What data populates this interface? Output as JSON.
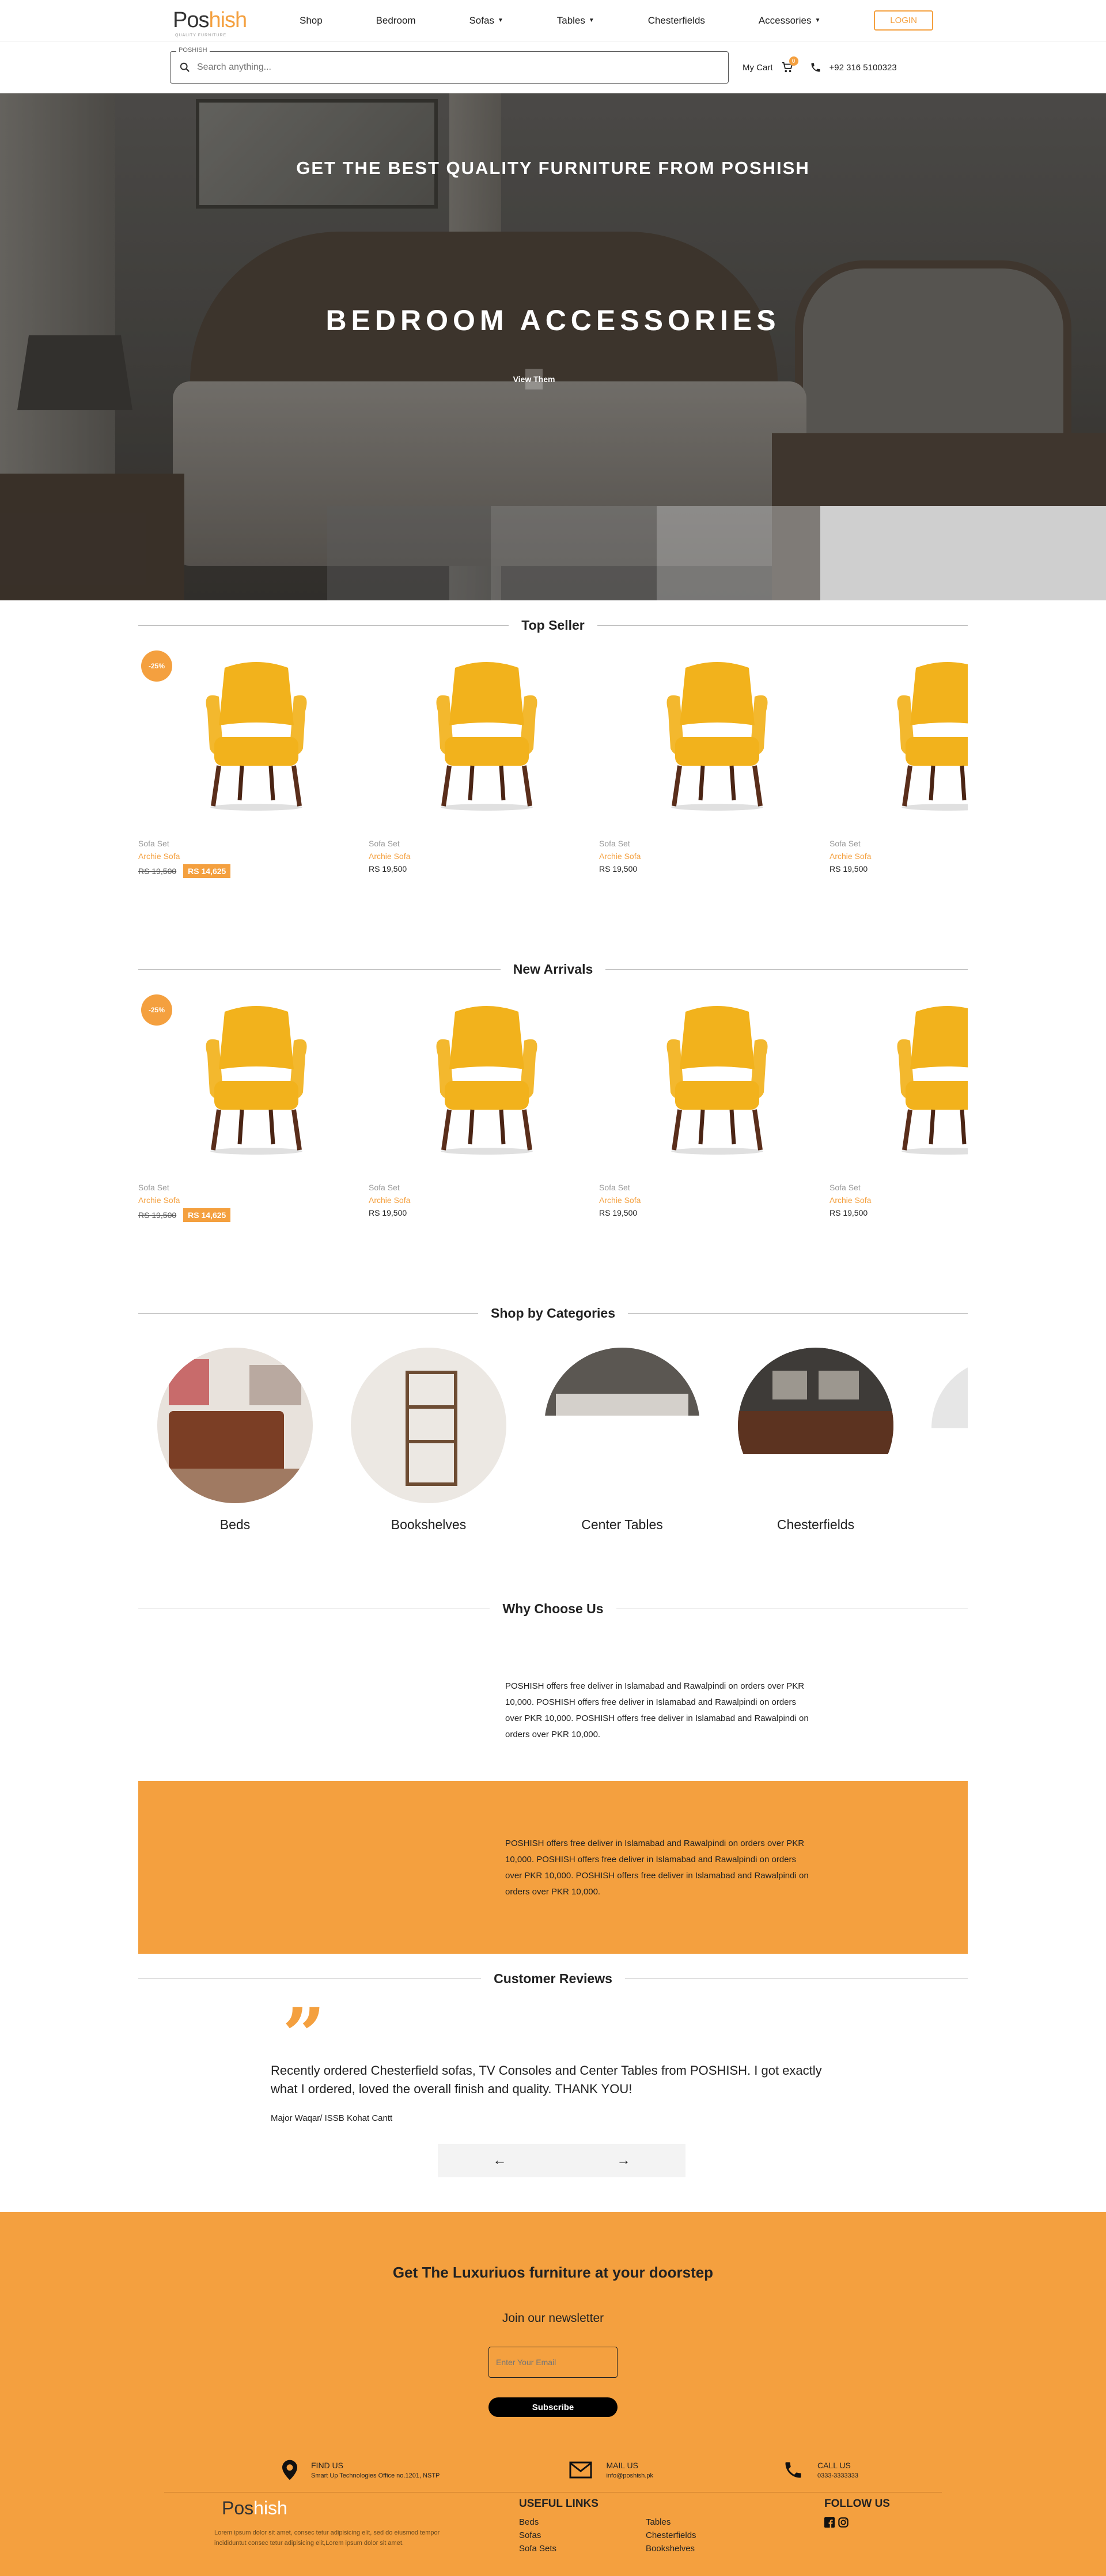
{
  "header": {
    "logo_main": "Pos",
    "logo_accent": "hish",
    "logo_tag": "QUALITY FURNITURE",
    "nav": [
      {
        "label": "Shop",
        "dropdown": false
      },
      {
        "label": "Bedroom",
        "dropdown": false
      },
      {
        "label": "Sofas",
        "dropdown": true
      },
      {
        "label": "Tables",
        "dropdown": true
      },
      {
        "label": "Chesterfields",
        "dropdown": false
      },
      {
        "label": "Accessories",
        "dropdown": true
      }
    ],
    "login": "LOGIN"
  },
  "search": {
    "label": "POSHISH",
    "placeholder": "Search anything...",
    "cart_label": "My Cart",
    "cart_count": "0",
    "phone": "+92 316 5100323"
  },
  "hero": {
    "subtitle": "GET THE BEST QUALITY FURNITURE FROM POSHISH",
    "title": "BEDROOM ACCESSORIES",
    "button": "View Them"
  },
  "top_seller": {
    "title": "Top Seller",
    "products": [
      {
        "badge": "-25%",
        "category": "Sofa Set",
        "name": "Archie Sofa",
        "old_price": "RS 19,500",
        "price": "RS 14,625"
      },
      {
        "badge": "",
        "category": "Sofa Set",
        "name": "Archie Sofa",
        "old_price": "",
        "price": "RS 19,500"
      },
      {
        "badge": "",
        "category": "Sofa Set",
        "name": "Archie Sofa",
        "old_price": "",
        "price": "RS 19,500"
      },
      {
        "badge": "",
        "category": "Sofa Set",
        "name": "Archie Sofa",
        "old_price": "",
        "price": "RS 19,500"
      }
    ]
  },
  "new_arrivals": {
    "title": "New Arrivals",
    "products": [
      {
        "badge": "-25%",
        "category": "Sofa Set",
        "name": "Archie Sofa",
        "old_price": "RS 19,500",
        "price": "RS 14,625"
      },
      {
        "badge": "",
        "category": "Sofa Set",
        "name": "Archie Sofa",
        "old_price": "",
        "price": "RS 19,500"
      },
      {
        "badge": "",
        "category": "Sofa Set",
        "name": "Archie Sofa",
        "old_price": "",
        "price": "RS 19,500"
      },
      {
        "badge": "",
        "category": "Sofa Set",
        "name": "Archie Sofa",
        "old_price": "",
        "price": "RS 19,500"
      }
    ]
  },
  "categories": {
    "title": "Shop by Categories",
    "items": [
      {
        "label": "Beds"
      },
      {
        "label": "Bookshelves"
      },
      {
        "label": "Center Tables"
      },
      {
        "label": "Chesterfields"
      },
      {
        "label": ""
      }
    ]
  },
  "why": {
    "title": "Why Choose Us",
    "text1": "POSHISH offers free deliver in Islamabad and Rawalpindi on orders over PKR 10,000. POSHISH offers free deliver in Islamabad and Rawalpindi on orders over PKR 10,000. POSHISH offers free deliver in Islamabad and Rawalpindi on orders over PKR 10,000.",
    "text2": "POSHISH offers free deliver in Islamabad and Rawalpindi on orders over PKR 10,000. POSHISH offers free deliver in Islamabad and Rawalpindi on orders over PKR 10,000. POSHISH offers free deliver in Islamabad and Rawalpindi on orders over PKR 10,000."
  },
  "reviews": {
    "title": "Customer Reviews",
    "text": "Recently ordered Chesterfield sofas, TV Consoles and Center Tables from POSHISH. I got exactly what I ordered, loved the overall finish and quality. THANK YOU!",
    "author": "Major Waqar/ ISSB Kohat Cantt",
    "prev": "←",
    "next": "→"
  },
  "footer": {
    "headline": "Get The Luxuriuos furniture at your doorstep",
    "join": "Join our newsletter",
    "email_placeholder": "Enter Your Email",
    "subscribe": "Subscribe",
    "find_title": "FIND US",
    "find_text": "Smart Up Technologies Office no.1201, NSTP",
    "mail_title": "MAIL US",
    "mail_text": "info@poshish.pk",
    "call_title": "CALL US",
    "call_text": "0333-3333333",
    "logo_main": "Pos",
    "logo_accent": "hish",
    "description": "Lorem ipsum dolor sit amet, consec tetur adipisicing elit, sed do eiusmod tempor incididuntut consec tetur adipisicing elit,Lorem ipsum dolor sit amet.",
    "useful_title": "USEFUL LINKS",
    "links": [
      "Beds",
      "Tables",
      "Sofas",
      "Chesterfields",
      "Sofa Sets",
      "Bookshelves"
    ],
    "follow_title": "FOLLOW US"
  },
  "colors": {
    "accent": "#f4a03f",
    "chair": "#f2b21c"
  }
}
